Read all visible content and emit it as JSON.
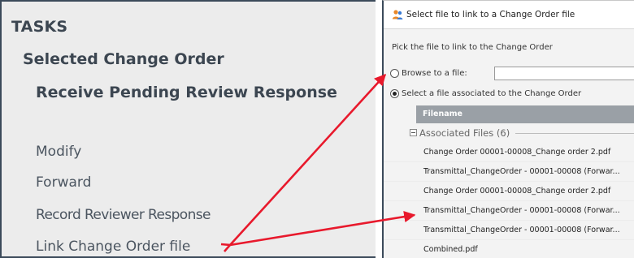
{
  "tasks_panel": {
    "heading": "TASKS",
    "section_title": "Selected Change Order",
    "current_task": "Receive Pending Review Response",
    "links": [
      {
        "label": "Modify"
      },
      {
        "label": "Forward"
      },
      {
        "label": "Record Reviewer Response"
      },
      {
        "label": "Link Change Order file"
      }
    ]
  },
  "dialog": {
    "title": "Select file to link to a Change Order file",
    "instruction": "Pick the file to link to the Change Order",
    "browse_option_label": "Browse to a file:",
    "browse_value": "",
    "associated_option_label": "Select a file associated to the Change Order",
    "selected_option": "associated",
    "grid": {
      "column_header": "Filename",
      "group_label": "Associated Files",
      "group_count": "(6)",
      "files": [
        "Change Order 00001-00008_Change order 2.pdf",
        "Transmittal_ChangeOrder - 00001-00008 (Forwar...",
        "Change Order 00001-00008_Change order 2.pdf",
        "Transmittal_ChangeOrder - 00001-00008 (Forwar...",
        "Transmittal_ChangeOrder - 00001-00008 (Forwar...",
        "Combined.pdf"
      ]
    }
  },
  "colors": {
    "panel_bg": "#ececec",
    "panel_text": "#3c4651",
    "arrow": "#e8192c",
    "grid_header_bg": "#9aa0a6"
  },
  "icons": {
    "dialog_app_icon": "people-icon",
    "group_toggle": "collapse-minus-icon"
  }
}
